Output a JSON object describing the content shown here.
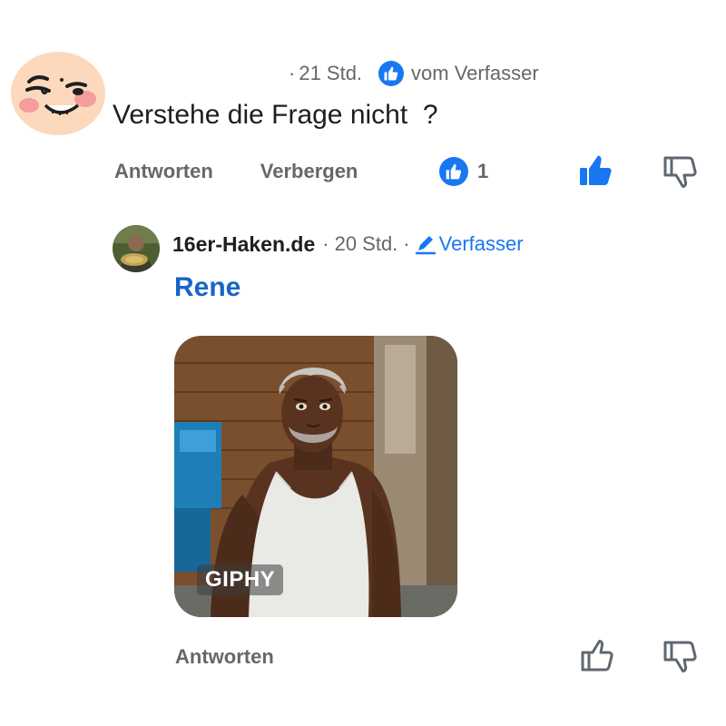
{
  "comment": {
    "meta": {
      "separator": "·",
      "time": "21 Std.",
      "liked_by_author_label": "vom Verfasser"
    },
    "text": "Verstehe die Frage nicht  ?",
    "actions": {
      "reply": "Antworten",
      "hide": "Verbergen"
    },
    "like_count": "1",
    "avatar_icon": "smirk-face-avatar"
  },
  "reply": {
    "author": "16er-Haken.de",
    "separator": "·",
    "time": "20 Std.",
    "separator2": "·",
    "role": "Verfasser",
    "mention": "Rene",
    "gif": {
      "badge": "GIPHY"
    },
    "actions": {
      "reply": "Antworten"
    }
  },
  "colors": {
    "accent": "#1877f2",
    "mention": "#1865c7",
    "muted": "#65676b",
    "text": "#1c1e21"
  }
}
